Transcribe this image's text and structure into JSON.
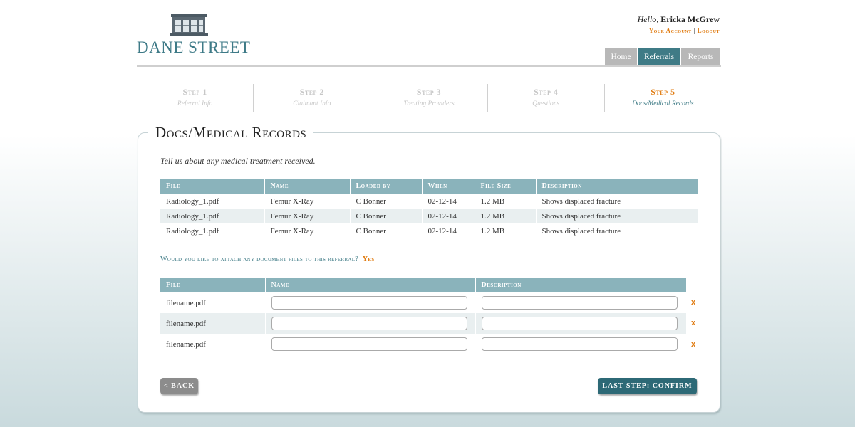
{
  "brand": {
    "name": "DANE STREET",
    "logo_icon": "building-icon",
    "color": "#3e7a87"
  },
  "user": {
    "greeting": "Hello,",
    "name": "Ericka McGrew",
    "account_link": "Your Account",
    "separator": "|",
    "logout_link": "Logout"
  },
  "nav": {
    "tabs": [
      {
        "label": "Home"
      },
      {
        "label": "Referrals"
      },
      {
        "label": "Reports"
      }
    ],
    "active": "Referrals"
  },
  "steps": [
    {
      "title": "Step 1",
      "subtitle": "Referral Info"
    },
    {
      "title": "Step 2",
      "subtitle": "Claimant Info"
    },
    {
      "title": "Step 3",
      "subtitle": "Treating Providers"
    },
    {
      "title": "Step 4",
      "subtitle": "Questions"
    },
    {
      "title": "Step 5",
      "subtitle": "Docs/Medical Records"
    }
  ],
  "current_step": 5,
  "panel": {
    "title": "Docs/Medical Records",
    "intro": "Tell us about any medical treatment received."
  },
  "docs_table": {
    "headers": [
      "File",
      "Name",
      "Loaded by",
      "When",
      "File Size",
      "Description"
    ],
    "rows": [
      [
        "Radiology_1.pdf",
        "Femur X-Ray",
        "C Bonner",
        "02-12-14",
        "1.2 MB",
        "Shows displaced fracture"
      ],
      [
        "Radiology_1.pdf",
        "Femur X-Ray",
        "C Bonner",
        "02-12-14",
        "1.2 MB",
        "Shows displaced fracture"
      ],
      [
        "Radiology_1.pdf",
        "Femur X-Ray",
        "C Bonner",
        "02-12-14",
        "1.2 MB",
        "Shows displaced fracture"
      ]
    ]
  },
  "attach": {
    "question": "Would you like to attach any document files to this referral?",
    "answer": "Yes"
  },
  "upload_table": {
    "headers": [
      "File",
      "Name",
      "Description"
    ],
    "rows": [
      {
        "file": "filename.pdf",
        "name": "",
        "description": "",
        "remove": "x"
      },
      {
        "file": "filename.pdf",
        "name": "",
        "description": "",
        "remove": "x"
      },
      {
        "file": "filename.pdf",
        "name": "",
        "description": "",
        "remove": "x"
      }
    ]
  },
  "buttons": {
    "back": "< Back",
    "confirm": "Last Step: Confirm >>"
  },
  "colors": {
    "accent": "#e07b10",
    "teal": "#3f7b86",
    "table_header": "#8ab3bb",
    "confirm_button": "#2d6976",
    "back_button": "#8c8c8c"
  }
}
